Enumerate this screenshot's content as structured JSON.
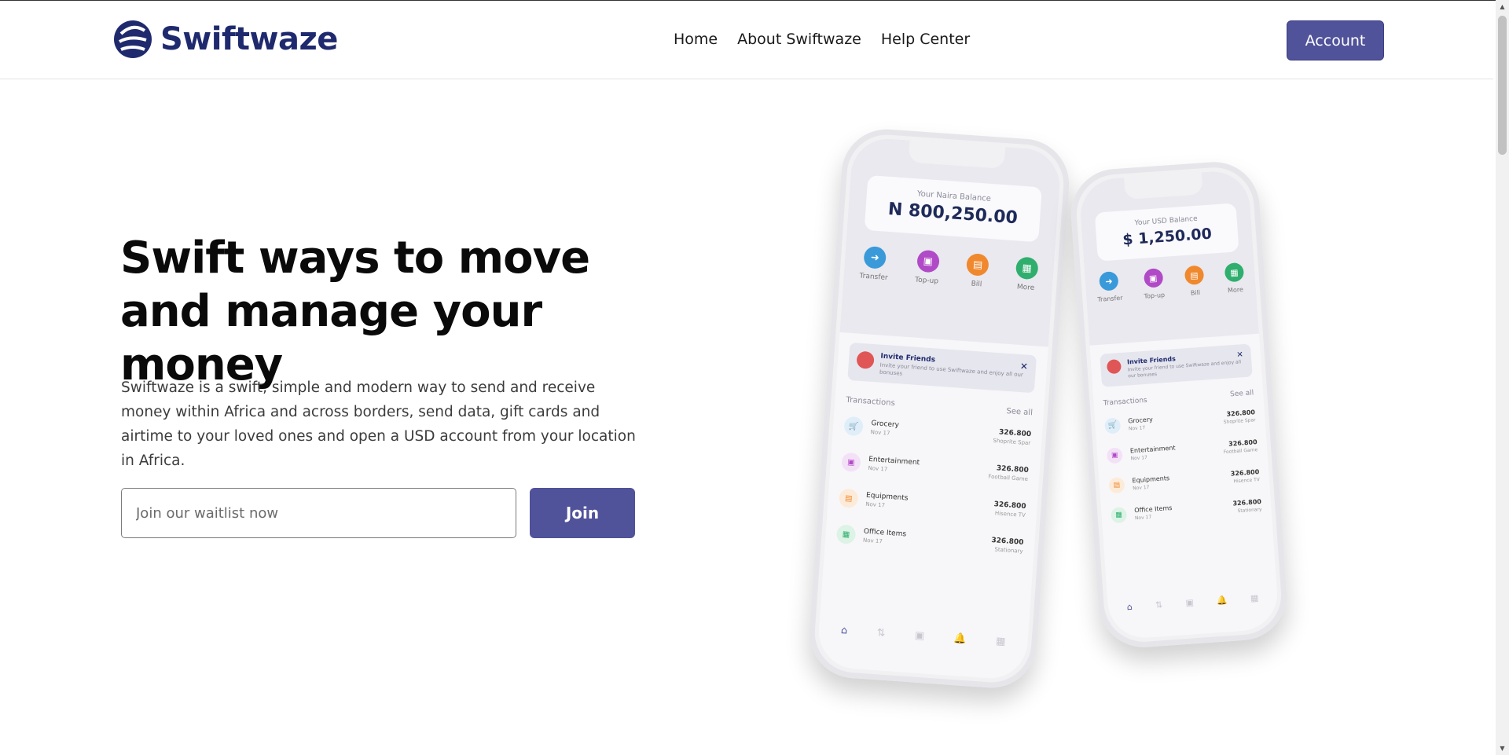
{
  "header": {
    "logo_text": "Swiftwaze",
    "nav": [
      {
        "label": "Home"
      },
      {
        "label": "About Swiftwaze"
      },
      {
        "label": "Help Center"
      }
    ],
    "account_label": "Account"
  },
  "hero": {
    "title": "Swift ways to move and manage your money",
    "description": "Swiftwaze is a swift, simple and modern way to send and receive money within Africa and across borders, send data, gift cards and airtime to your loved ones and open a USD account from your location in Africa.",
    "waitlist_placeholder": "Join our waitlist now",
    "join_label": "Join"
  },
  "phone_naira": {
    "balance_label": "Your Naira Balance",
    "balance_value": "N 800,250.00",
    "actions": [
      {
        "label": "Transfer",
        "color": "#3a9ad9"
      },
      {
        "label": "Top-up",
        "color": "#b14ac6"
      },
      {
        "label": "Bill",
        "color": "#f0882e"
      },
      {
        "label": "More",
        "color": "#2fae6d"
      }
    ],
    "invite_title": "Invite Friends",
    "invite_sub": "Invite your friend to use Swiftwaze and enjoy all our bonuses",
    "transactions_label": "Transactions",
    "see_all": "See all",
    "transactions": [
      {
        "name": "Grocery",
        "date": "Nov 17",
        "amount": "326.800",
        "merchant": "Shoprite Spar",
        "color": "#dfeef9"
      },
      {
        "name": "Entertainment",
        "date": "Nov 17",
        "amount": "326.800",
        "merchant": "Football Game",
        "color": "#f3e2f7"
      },
      {
        "name": "Equipments",
        "date": "Nov 17",
        "amount": "326.800",
        "merchant": "Hisence TV",
        "color": "#fdebd9"
      },
      {
        "name": "Office Items",
        "date": "Nov 17",
        "amount": "326.800",
        "merchant": "Stationary",
        "color": "#dcf3e6"
      }
    ]
  },
  "phone_usd": {
    "balance_label": "Your USD Balance",
    "balance_value": "$ 1,250.00",
    "actions": [
      {
        "label": "Transfer",
        "color": "#3a9ad9"
      },
      {
        "label": "Top-up",
        "color": "#b14ac6"
      },
      {
        "label": "Bill",
        "color": "#f0882e"
      },
      {
        "label": "More",
        "color": "#2fae6d"
      }
    ],
    "invite_title": "Invite Friends",
    "invite_sub": "Invite your friend to use Swiftwaze and enjoy all our bonuses",
    "transactions_label": "Transactions",
    "see_all": "See all",
    "transactions": [
      {
        "name": "Grocery",
        "date": "Nov 17",
        "amount": "326.800",
        "merchant": "Shoprite Spar",
        "color": "#dfeef9"
      },
      {
        "name": "Entertainment",
        "date": "Nov 17",
        "amount": "326.800",
        "merchant": "Football Game",
        "color": "#f3e2f7"
      },
      {
        "name": "Equipments",
        "date": "Nov 17",
        "amount": "326.800",
        "merchant": "Hisence TV",
        "color": "#fdebd9"
      },
      {
        "name": "Office Items",
        "date": "Nov 17",
        "amount": "326.800",
        "merchant": "Stationary",
        "color": "#dcf3e6"
      }
    ]
  },
  "colors": {
    "brand": "#50529a",
    "logo": "#1f2a6e"
  }
}
